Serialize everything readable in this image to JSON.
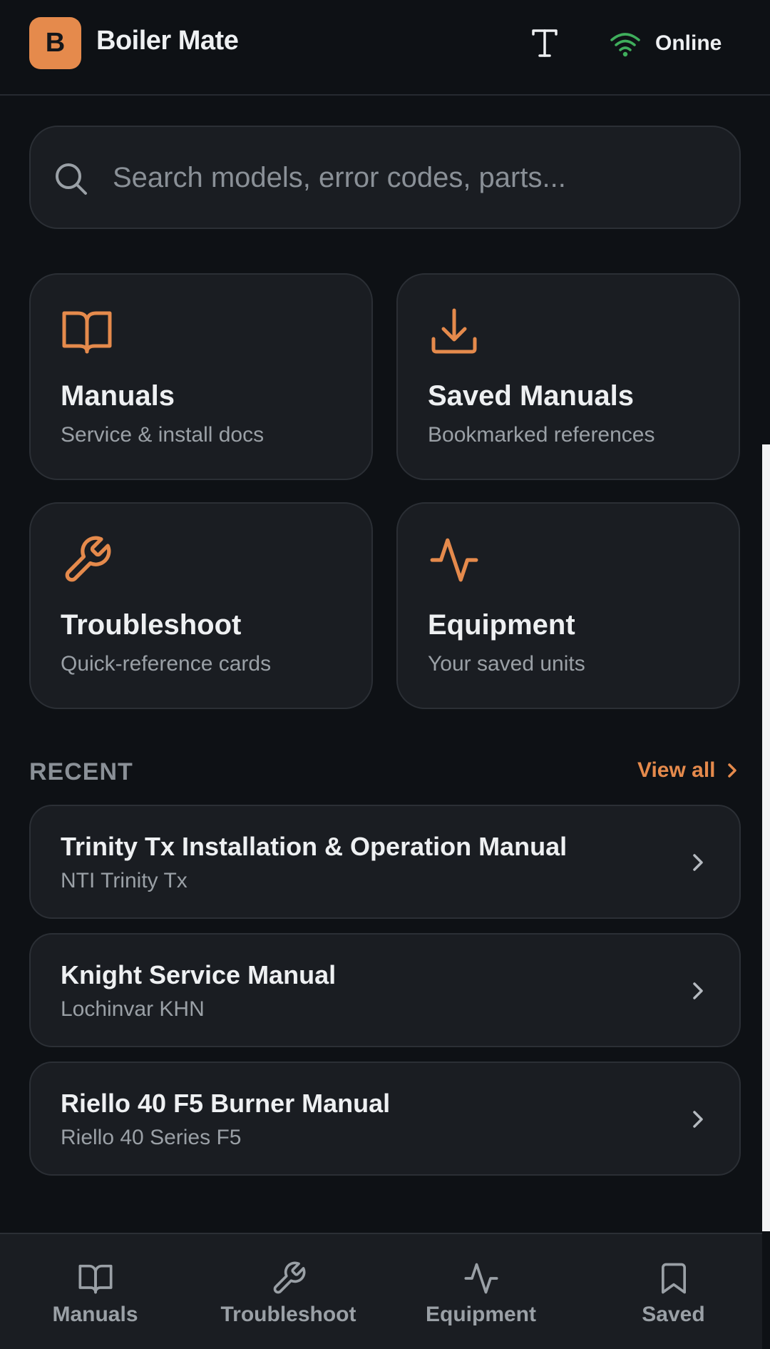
{
  "header": {
    "logo_letter": "B",
    "title": "Boiler Mate",
    "status": "Online",
    "status_color": "#3fae5c",
    "accent_color": "#e58a4c"
  },
  "search": {
    "placeholder": "Search models, error codes, parts..."
  },
  "tiles": [
    {
      "title": "Manuals",
      "subtitle": "Service & install docs",
      "icon": "book-open-icon"
    },
    {
      "title": "Saved Manuals",
      "subtitle": "Bookmarked references",
      "icon": "download-icon"
    },
    {
      "title": "Troubleshoot",
      "subtitle": "Quick-reference cards",
      "icon": "wrench-icon"
    },
    {
      "title": "Equipment",
      "subtitle": "Your saved units",
      "icon": "activity-icon"
    }
  ],
  "recent": {
    "label": "RECENT",
    "view_all": "View all",
    "items": [
      {
        "title": "Trinity Tx Installation & Operation Manual",
        "subtitle": "NTI Trinity Tx"
      },
      {
        "title": "Knight Service Manual",
        "subtitle": "Lochinvar KHN"
      },
      {
        "title": "Riello 40 F5 Burner Manual",
        "subtitle": "Riello 40 Series F5"
      }
    ]
  },
  "bottom_nav": [
    {
      "label": "Manuals",
      "icon": "book-open-icon"
    },
    {
      "label": "Troubleshoot",
      "icon": "wrench-icon"
    },
    {
      "label": "Equipment",
      "icon": "activity-icon"
    },
    {
      "label": "Saved",
      "icon": "bookmark-icon"
    }
  ]
}
